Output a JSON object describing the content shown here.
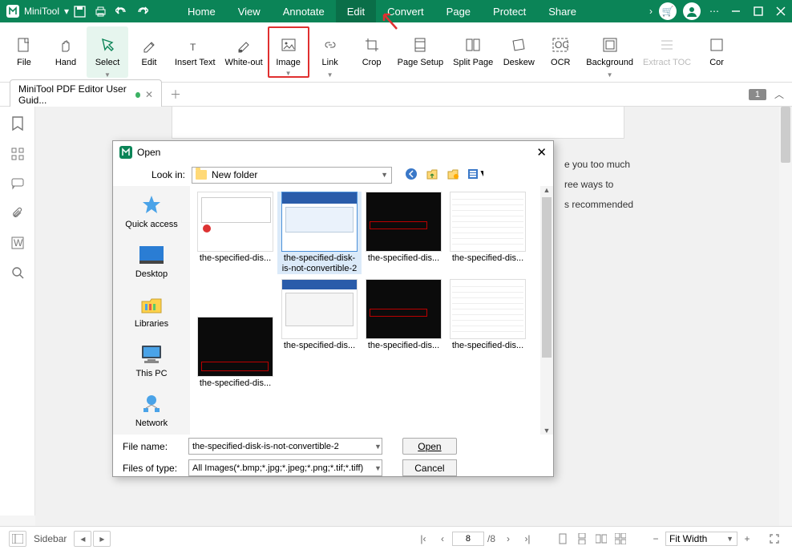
{
  "app": {
    "name": "MiniTool"
  },
  "menu": {
    "items": [
      "Home",
      "View",
      "Annotate",
      "Edit",
      "Convert",
      "Page",
      "Protect",
      "Share"
    ],
    "active": 3
  },
  "ribbon": {
    "buttons": [
      {
        "label": "File"
      },
      {
        "label": "Hand"
      },
      {
        "label": "Select",
        "sel": true,
        "dd": true
      },
      {
        "label": "Edit"
      },
      {
        "label": "Insert Text"
      },
      {
        "label": "White-out"
      },
      {
        "label": "Image",
        "red": true,
        "dd": true
      },
      {
        "label": "Link",
        "dd": true
      },
      {
        "label": "Crop"
      },
      {
        "label": "Page Setup"
      },
      {
        "label": "Split Page"
      },
      {
        "label": "Deskew"
      },
      {
        "label": "OCR"
      },
      {
        "label": "Background",
        "dd": true
      },
      {
        "label": "Extract TOC",
        "disabled": true
      },
      {
        "label": "Cor"
      }
    ]
  },
  "tab": {
    "title": "MiniTool PDF Editor User Guid...",
    "page_badge": "1"
  },
  "doc_text": {
    "l1": "e you too much",
    "l2": "ree ways to",
    "l3": "s recommended"
  },
  "dialog": {
    "title": "Open",
    "lookin_label": "Look in:",
    "lookin_value": "New folder",
    "places": [
      "Quick access",
      "Desktop",
      "Libraries",
      "This PC",
      "Network"
    ],
    "files_row1": [
      "the-specified-dis...",
      "the-specified-disk-is-not-convertible-2",
      "the-specified-dis...",
      "the-specified-dis..."
    ],
    "files_row2": [
      "the-specified-dis...",
      "the-specified-dis...",
      "the-specified-dis...",
      "the-specified-dis..."
    ],
    "selected_index": 1,
    "filename_label": "File name:",
    "filename_value": "the-specified-disk-is-not-convertible-2",
    "filetype_label": "Files of type:",
    "filetype_value": "All Images(*.bmp;*.jpg;*.jpeg;*.png;*.tif;*.tiff)",
    "open_btn": "Open",
    "cancel_btn": "Cancel"
  },
  "status": {
    "sidebar": "Sidebar",
    "page_current": "8",
    "page_total": "/8",
    "zoom": "Fit Width"
  }
}
